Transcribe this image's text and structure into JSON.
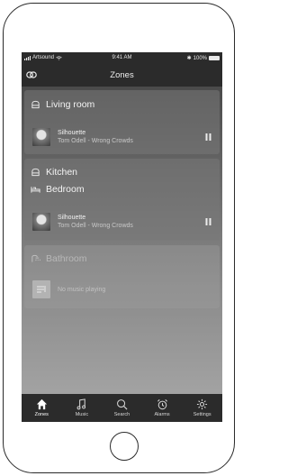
{
  "status_bar": {
    "carrier": "Artsound",
    "time": "9:41 AM",
    "battery": "100%"
  },
  "header": {
    "title": "Zones"
  },
  "zones": [
    {
      "rooms": [
        "Living room"
      ],
      "track": {
        "title": "Silhouette",
        "artist": "Tom Odell - Wrong Crowds"
      },
      "state": "playing"
    },
    {
      "rooms": [
        "Kitchen",
        "Bedroom"
      ],
      "track": {
        "title": "Silhouette",
        "artist": "Tom Odell - Wrong Crowds"
      },
      "state": "playing"
    },
    {
      "rooms": [
        "Bathroom"
      ],
      "track": {
        "message": "No music playing"
      },
      "state": "idle"
    }
  ],
  "tabs": [
    {
      "label": "Zones",
      "icon": "home-icon",
      "active": true
    },
    {
      "label": "Music",
      "icon": "music-note-icon"
    },
    {
      "label": "Search",
      "icon": "search-icon"
    },
    {
      "label": "Alarms",
      "icon": "alarm-clock-icon"
    },
    {
      "label": "Settings",
      "icon": "gear-icon"
    }
  ],
  "colors": {
    "bar": "#2b2b2b",
    "text": "#f2f2f2",
    "muted": "#c9c9c9"
  }
}
